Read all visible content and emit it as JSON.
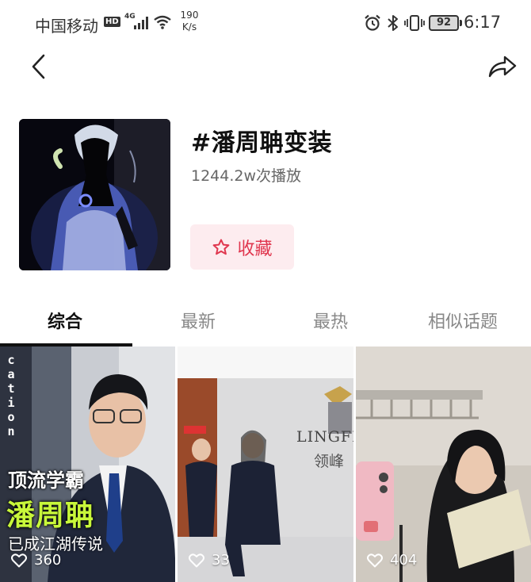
{
  "status_bar": {
    "carrier": "中国移动",
    "hd": "HD",
    "network": "4G",
    "speed_value": "190",
    "speed_unit": "K/s",
    "battery": "92",
    "time": "6:17"
  },
  "topic": {
    "title": "#潘周聃变装",
    "play_count": "1244.2w次播放",
    "favorite_label": "收藏"
  },
  "tabs": [
    {
      "label": "综合",
      "active": true
    },
    {
      "label": "最新",
      "active": false
    },
    {
      "label": "最热",
      "active": false
    },
    {
      "label": "相似话题",
      "active": false
    }
  ],
  "videos": [
    {
      "likes": "360",
      "vertical_text": "cation",
      "caption_line1": "顶流学霸",
      "caption_line2": "潘周聃",
      "caption_line3": "已成江湖传说"
    },
    {
      "likes": "33",
      "brand_text": "LINGFE",
      "brand_text_cn": "领峰"
    },
    {
      "likes": "404"
    }
  ],
  "icons": {
    "back": "chevron-left-icon",
    "share": "share-arrow-icon",
    "favorite": "star-outline-icon",
    "like": "heart-outline-icon"
  },
  "colors": {
    "accent": "#e0374f",
    "favorite_bg": "#fdecef",
    "caption_highlight": "#c8f73a"
  }
}
